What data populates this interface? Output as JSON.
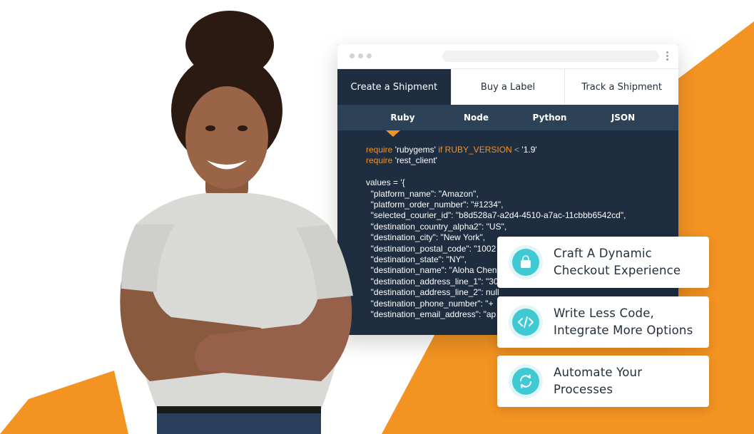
{
  "tabs": [
    {
      "label": "Create a Shipment",
      "active": true
    },
    {
      "label": "Buy a Label",
      "active": false
    },
    {
      "label": "Track a Shipment",
      "active": false
    }
  ],
  "languages": [
    "Ruby",
    "Node",
    "Python",
    "JSON"
  ],
  "selected_language": "Ruby",
  "code": {
    "line1": {
      "kw": "require",
      "str": "'rubygems'",
      "kw2": "if",
      "const": "RUBY_VERSION",
      "op": "<",
      "ver": "'1.9'"
    },
    "line2": {
      "kw": "require",
      "str": "'rest_client'"
    },
    "values_open": "values = '{",
    "fields": [
      "\"platform_name\": \"Amazon\",",
      "\"platform_order_number\": \"#1234\",",
      "\"selected_courier_id\": \"b8d528a7-a2d4-4510-a7ac-11cbbb6542cd\",",
      "\"destination_country_alpha2\": \"US\",",
      "\"destination_city\": \"New York\",",
      "\"destination_postal_code\": \"1002",
      "\"destination_state\": \"NY\",",
      "\"destination_name\": \"Aloha Chen",
      "\"destination_address_line_1\": \"30",
      "\"destination_address_line_2\": null",
      "\"destination_phone_number\": \"+",
      "\"destination_email_address\": \"ap"
    ]
  },
  "features": [
    {
      "icon": "shopping-bag-icon",
      "line1": "Craft A Dynamic",
      "line2": "Checkout Experience"
    },
    {
      "icon": "code-icon",
      "line1": "Write Less Code,",
      "line2": "Integrate More Options"
    },
    {
      "icon": "refresh-icon",
      "line1": "Automate Your",
      "line2": "Processes"
    }
  ],
  "colors": {
    "accent_orange": "#f39322",
    "navy": "#1e2d3f",
    "teal": "#3fc9d3"
  }
}
